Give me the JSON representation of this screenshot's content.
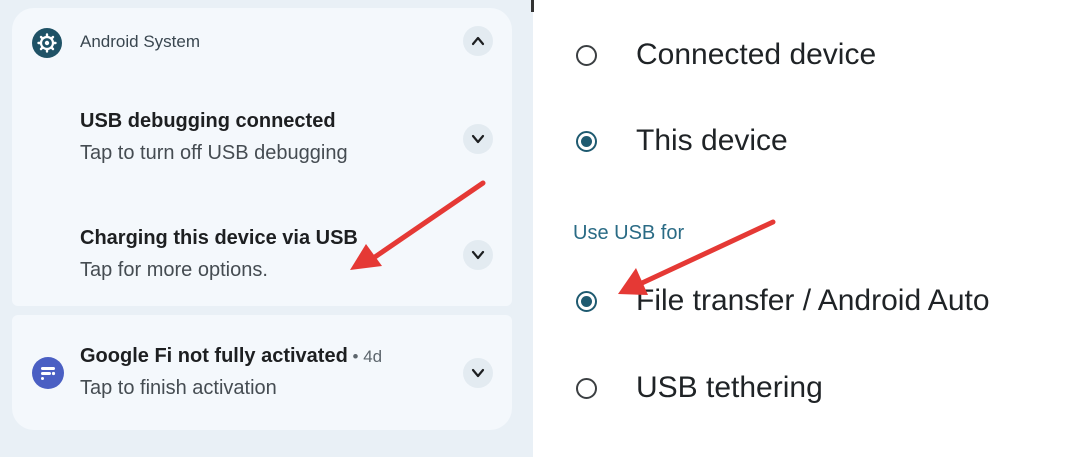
{
  "left_panel": {
    "app_header": {
      "app_name": "Android System",
      "app_icon": "settings-gear-icon",
      "collapse_icon": "chevron-up-icon"
    },
    "notifications": [
      {
        "title": "USB debugging connected",
        "subtitle": "Tap to turn off USB debugging",
        "expand_icon": "chevron-down-icon"
      },
      {
        "title": "Charging this device via USB",
        "subtitle": "Tap for more options.",
        "expand_icon": "chevron-down-icon"
      }
    ],
    "google_fi": {
      "title": "Google Fi not fully activated",
      "age": " • 4d",
      "subtitle": "Tap to finish activation",
      "app_icon": "google-fi-icon",
      "expand_icon": "chevron-down-icon"
    }
  },
  "right_panel": {
    "controlled_by": [
      {
        "label": "Connected device",
        "selected": false
      },
      {
        "label": "This device",
        "selected": true
      }
    ],
    "section_label": "Use USB for",
    "use_usb_for": [
      {
        "label": "File transfer / Android Auto",
        "selected": true
      },
      {
        "label": "USB tethering",
        "selected": false
      }
    ]
  },
  "annotations": {
    "arrow_color": "#e53935",
    "accent_color": "#1e5a70"
  }
}
